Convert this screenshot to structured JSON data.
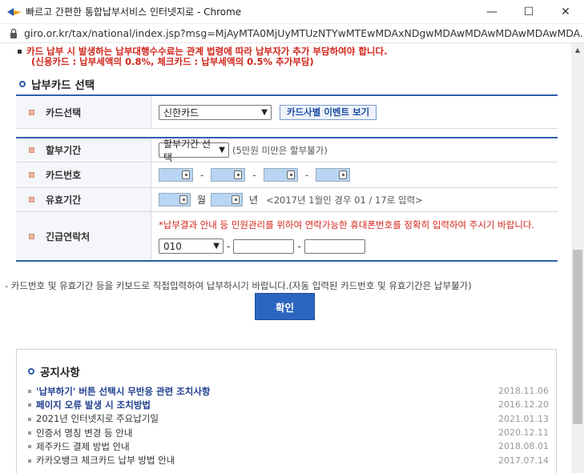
{
  "window": {
    "title": "빠르고 간편한 통합납부서비스 인터넷지로 - Chrome",
    "url": "giro.or.kr/tax/national/index.jsp?msg=MjAyMTA0MjUyMTUzNTYwMTEwMDAxNDgwMDAwMDAwMDAwMDAwMDA..."
  },
  "warning": {
    "line1": "카드 납부 시 발생하는 납부대행수수료는 관계 법령에 따라 납부자가 추가 부담하여야 합니다.",
    "line2": "(신용카드 : 납부세액의 0.8%, 체크카드 : 납부세액의 0.5% 추가부담)"
  },
  "section": {
    "title": "납부카드 선택"
  },
  "card_select": {
    "label": "카드선택",
    "value": "신한카드",
    "event_button": "카드사별 이벤트 보기"
  },
  "installment": {
    "label": "할부기간",
    "value": "할부기간 선택",
    "hint": "(5만원 미만은 할부불가)"
  },
  "card_number": {
    "label": "카드번호",
    "dash": "-"
  },
  "expiry": {
    "label": "유효기간",
    "month_unit": "월",
    "year_unit": "년",
    "hint": "<2017년 1월인 경우 01 / 17로 입력>"
  },
  "contact": {
    "label": "긴급연락처",
    "note": "*납부결과 안내 등 민원관리를 위하여 연락가능한 휴대폰번호를 정확히 입력하여 주시기 바랍니다.",
    "prefix": "010",
    "dash": "-"
  },
  "bottom_note": "- 카드번호 및 유효기간 등을 키보드로 직접입력하여 납부하시기 바랍니다.(자동 입력된 카드번호 및 유효기간은 납부불가)",
  "confirm_button": "확인",
  "notice": {
    "title": "공지사항",
    "items": [
      {
        "text": "'납부하기' 버튼 선택시 무반응 관련 조치사항",
        "date": "2018.11.06"
      },
      {
        "text": "페이지 오류 발생 시 조치방법",
        "date": "2016.12.20"
      },
      {
        "text": "2021년 인터넷지로 주요납기일",
        "date": "2021.01.13"
      },
      {
        "text": "인증서 명칭 변경 등 안내",
        "date": "2020.12.11"
      },
      {
        "text": "제주카드 결제 방법 안내",
        "date": "2018.08.01"
      },
      {
        "text": "카카오뱅크 체크카드 납부 방법 안내",
        "date": "2017.07.14"
      }
    ]
  },
  "colors": {
    "accent": "#2d66c0",
    "warning": "#d1241a"
  }
}
